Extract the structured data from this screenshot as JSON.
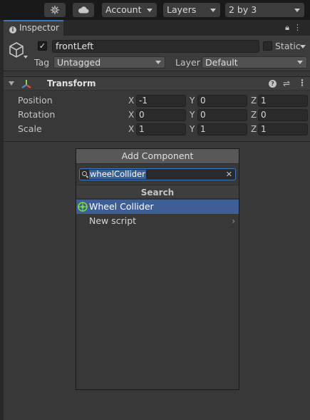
{
  "toolbar": {
    "account": "Account",
    "layers": "Layers",
    "layout": "2 by 3"
  },
  "inspector": {
    "tab_label": "Inspector",
    "object": {
      "active": true,
      "name": "frontLeft",
      "static_label": "Static",
      "tag_label": "Tag",
      "tag_value": "Untagged",
      "layer_label": "Layer",
      "layer_value": "Default"
    },
    "transform": {
      "title": "Transform",
      "position": {
        "label": "Position",
        "x": "-1",
        "y": "0",
        "z": "1"
      },
      "rotation": {
        "label": "Rotation",
        "x": "0",
        "y": "0",
        "z": "0"
      },
      "scale": {
        "label": "Scale",
        "x": "1",
        "y": "1",
        "z": "1"
      },
      "axes": {
        "x": "X",
        "y": "Y",
        "z": "Z"
      }
    }
  },
  "add_component": {
    "title": "Add Component",
    "search_value": "wheelCollider",
    "results_header": "Search",
    "items": [
      {
        "label": "Wheel Collider"
      },
      {
        "label": "New script"
      }
    ]
  },
  "colors": {
    "accent": "#3a79bb",
    "selection": "#3e5f96",
    "wheel_collider_icon": "#7fd83c"
  },
  "icons": {
    "toolbar": [
      "collab-icon",
      "cloud-icon"
    ],
    "tab": [
      "info-icon",
      "lock-icon",
      "menu-icon"
    ],
    "object": "cube-icon",
    "transform": [
      "transform-axes-icon",
      "help-icon",
      "preset-icon",
      "more-icon"
    ],
    "popup": [
      "search-icon",
      "clear-icon",
      "wheel-collider-icon",
      "chevron-right-icon"
    ]
  }
}
